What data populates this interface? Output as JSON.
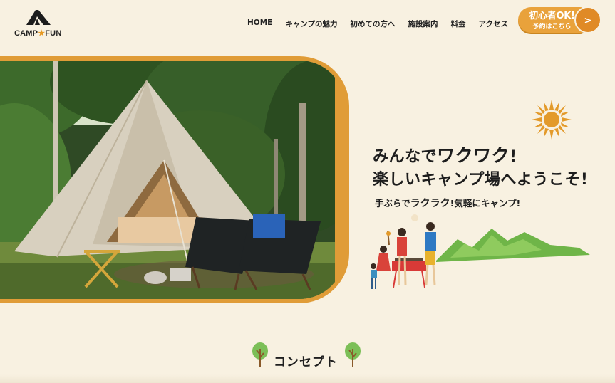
{
  "logo": {
    "text_left": "CAMP",
    "text_right": "FUN",
    "icon": "tent-logo-icon"
  },
  "nav": {
    "items": [
      {
        "label": "HOME"
      },
      {
        "label": "キャンプの魅力"
      },
      {
        "label": "初めての方へ"
      },
      {
        "label": "施設案内"
      },
      {
        "label": "料金"
      },
      {
        "label": "アクセス"
      }
    ]
  },
  "cta": {
    "top": "初心者OK!",
    "bottom": "予約はこちら",
    "arrow": ">"
  },
  "hero": {
    "headline_line1_a": "みんなで",
    "headline_line1_b": "ワクワク",
    "headline_line1_c": "!",
    "headline_line2": "楽しいキャンプ場へようこそ!",
    "subline_a": "手ぶらで",
    "subline_b": "ラクラク",
    "subline_c": "!気軽にキャンプ!"
  },
  "concept": {
    "title": "コンセプト"
  },
  "colors": {
    "accent": "#e9a23b",
    "background": "#f8f1e1",
    "frame": "#e09c37"
  }
}
